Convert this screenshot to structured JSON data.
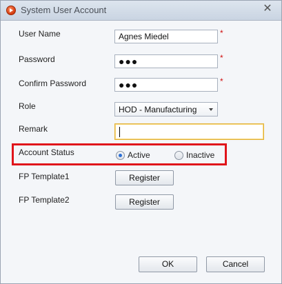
{
  "window": {
    "title": "System User Account",
    "close_glyph": "✕"
  },
  "form": {
    "user_name": {
      "label": "User Name",
      "value": "Agnes Miedel",
      "required_mark": "*"
    },
    "password": {
      "label": "Password",
      "value": "●●●",
      "required_mark": "*"
    },
    "confirm_password": {
      "label": "Confirm Password",
      "value": "●●●",
      "required_mark": "*"
    },
    "role": {
      "label": "Role",
      "value": "HOD - Manufacturing"
    },
    "remark": {
      "label": "Remark",
      "value": ""
    },
    "account_status": {
      "label": "Account Status",
      "options": [
        {
          "label": "Active",
          "selected": true
        },
        {
          "label": "Inactive",
          "selected": false
        }
      ]
    },
    "fp_template1": {
      "label": "FP Template1",
      "button": "Register"
    },
    "fp_template2": {
      "label": "FP Template2",
      "button": "Register"
    }
  },
  "footer": {
    "ok": "OK",
    "cancel": "Cancel"
  },
  "colors": {
    "highlight": "#e0141a",
    "required": "#d01010",
    "accent": "#2b6fd6"
  }
}
